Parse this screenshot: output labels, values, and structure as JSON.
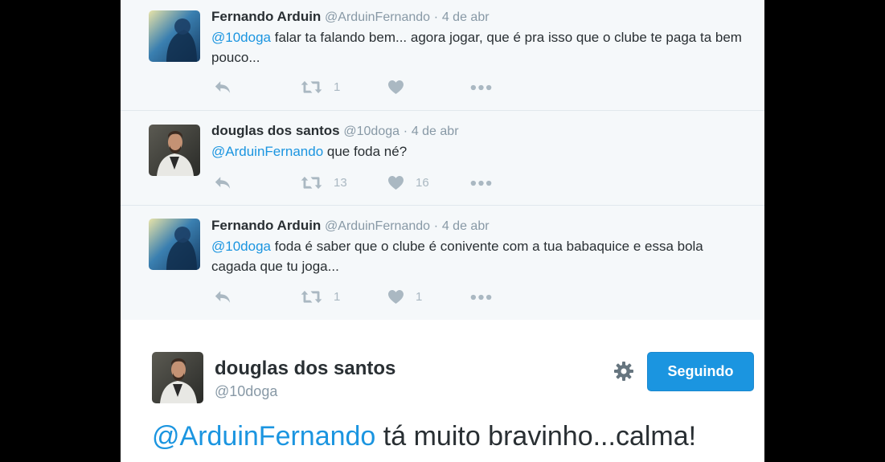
{
  "tweets": [
    {
      "name": "Fernando Arduin",
      "handle": "@ArduinFernando",
      "date": "4 de abr",
      "mention": "@10doga",
      "text": " falar ta falando bem... agora jogar, que é pra isso que o clube te paga ta bem pouco...",
      "retweets": "1",
      "likes": ""
    },
    {
      "name": "douglas dos santos",
      "handle": "@10doga",
      "date": "4 de abr",
      "mention": "@ArduinFernando",
      "text": " que foda né?",
      "retweets": "13",
      "likes": "16"
    },
    {
      "name": "Fernando Arduin",
      "handle": "@ArduinFernando",
      "date": "4 de abr",
      "mention": "@10doga",
      "text": " foda é saber que o clube é conivente com a tua babaquice e essa bola cagada que tu joga...",
      "retweets": "1",
      "likes": "1"
    }
  ],
  "separator": "·",
  "main_tweet": {
    "name": "douglas dos santos",
    "handle": "@10doga",
    "follow_label": "Seguindo",
    "mention": "@ArduinFernando",
    "text": " tá muito bravinho...calma!"
  },
  "colors": {
    "accent": "#1b95e0",
    "muted": "#aab8c2",
    "background": "#f5f8fa"
  },
  "icons": [
    "reply-icon",
    "retweet-icon",
    "heart-icon",
    "more-icon",
    "gear-icon"
  ]
}
